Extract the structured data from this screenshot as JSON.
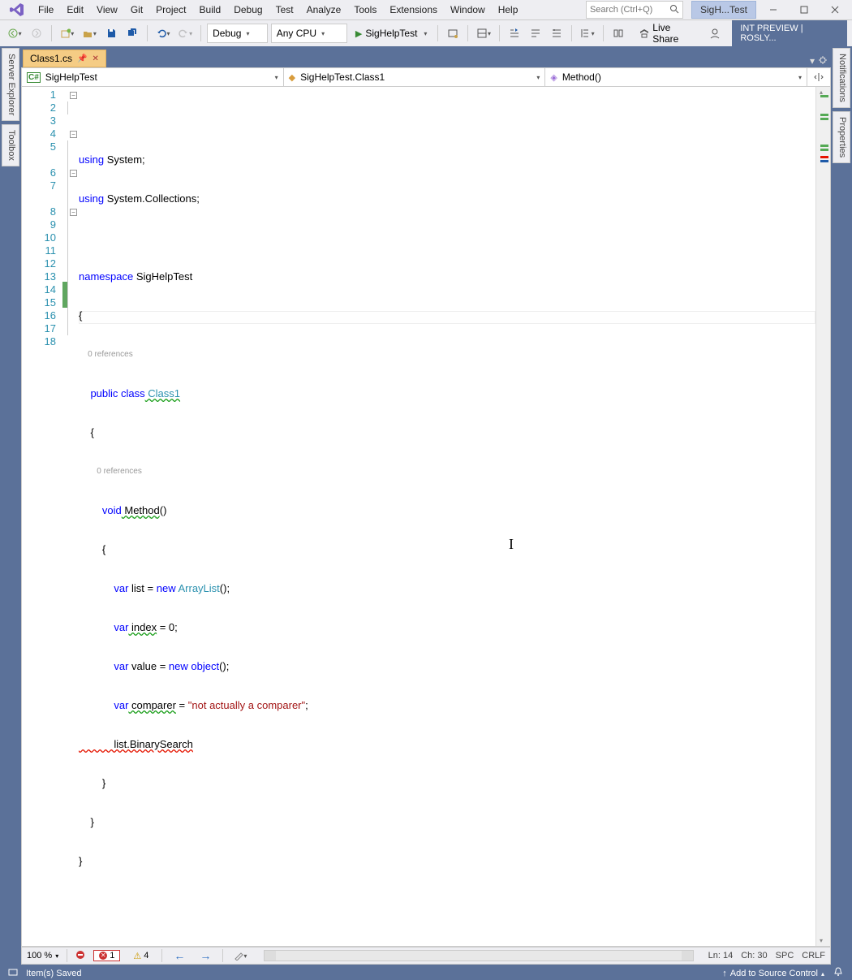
{
  "menu": [
    "File",
    "Edit",
    "View",
    "Git",
    "Project",
    "Build",
    "Debug",
    "Test",
    "Analyze",
    "Tools",
    "Extensions",
    "Window",
    "Help"
  ],
  "search_placeholder": "Search (Ctrl+Q)",
  "title_short": "SigH...Test",
  "toolbar": {
    "config": "Debug",
    "platform": "Any CPU",
    "start_label": "SigHelpTest",
    "live_share": "Live Share",
    "preview": "INT PREVIEW | ROSLY..."
  },
  "file_tab": "Class1.cs",
  "nav": {
    "project": "SigHelpTest",
    "type": "SigHelpTest.Class1",
    "member": "Method()"
  },
  "code": {
    "l1a": "using",
    "l1b": " System;",
    "l2a": "using",
    "l2b": " System.Collections;",
    "l4a": "namespace",
    "l4b": " SigHelpTest",
    "l5": "{",
    "ref0": "0 references",
    "l6a": "    public",
    "l6b": " class",
    "l6c": " Class1",
    "l7": "    {",
    "ref1": "0 references",
    "l8a": "        void",
    "l8b": " Method",
    "l8c": "()",
    "l9": "        {",
    "l10a": "            var",
    "l10b": " list = ",
    "l10c": "new",
    "l10d": " ArrayList",
    "l10e": "();",
    "l11a": "            var",
    "l11b": " index",
    "l11c": " = 0;",
    "l12a": "            var",
    "l12b": " value = ",
    "l12c": "new",
    "l12d": " object",
    "l12e": "();",
    "l13a": "            var",
    "l13b": " comparer",
    "l13c": " = ",
    "l13d": "\"not actually a comparer\"",
    "l13e": ";",
    "l14a": "            list.BinarySearch",
    "l15": "        }",
    "l16": "    }",
    "l17": "}"
  },
  "editor_status": {
    "zoom": "100 %",
    "errors": "1",
    "warnings": "4",
    "ln": "Ln: 14",
    "ch": "Ch: 30",
    "ws": "SPC",
    "eol": "CRLF"
  },
  "status": {
    "left": "Item(s) Saved",
    "source_control": "Add to Source Control"
  },
  "side": {
    "server_explorer": "Server Explorer",
    "toolbox": "Toolbox",
    "notifications": "Notifications",
    "properties": "Properties"
  }
}
